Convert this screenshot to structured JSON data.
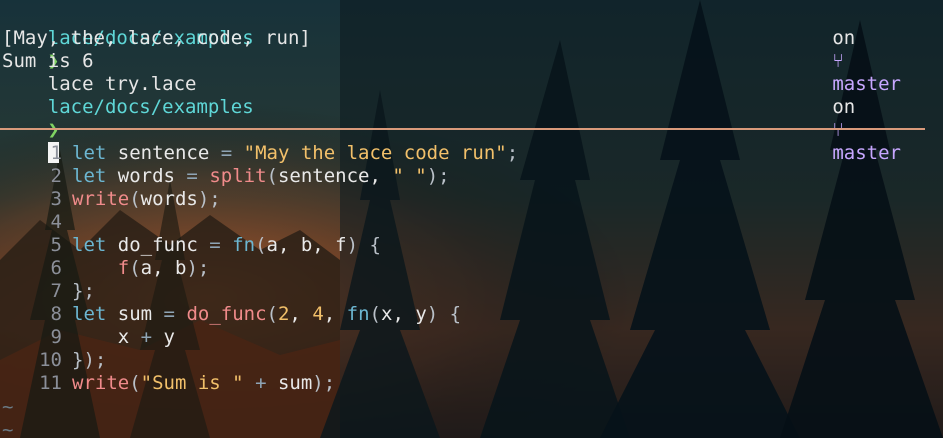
{
  "prompt": {
    "path": "lace/docs/examples",
    "chevron": "❯",
    "on_label": "on",
    "branch_icon": "git-branch-icon",
    "branch": "master"
  },
  "history": {
    "command": "lace try.lace",
    "output_1": "[May, the, lace, code, run]",
    "output_2": "Sum is 6"
  },
  "editor": {
    "lines": [
      {
        "n": "1",
        "tokens": [
          {
            "t": "let",
            "c": "kw"
          },
          {
            "t": " sentence ",
            "c": "id"
          },
          {
            "t": "=",
            "c": "op"
          },
          {
            "t": " ",
            "c": "id"
          },
          {
            "t": "\"May the lace code run\"",
            "c": "str"
          },
          {
            "t": ";",
            "c": "pun"
          }
        ]
      },
      {
        "n": "2",
        "tokens": [
          {
            "t": "let",
            "c": "kw"
          },
          {
            "t": " words ",
            "c": "id"
          },
          {
            "t": "=",
            "c": "op"
          },
          {
            "t": " ",
            "c": "id"
          },
          {
            "t": "split",
            "c": "fnc"
          },
          {
            "t": "(",
            "c": "pun"
          },
          {
            "t": "sentence, ",
            "c": "id"
          },
          {
            "t": "\" \"",
            "c": "str"
          },
          {
            "t": ");",
            "c": "pun"
          }
        ]
      },
      {
        "n": "3",
        "tokens": [
          {
            "t": "write",
            "c": "fnc"
          },
          {
            "t": "(",
            "c": "pun"
          },
          {
            "t": "words",
            "c": "id"
          },
          {
            "t": ");",
            "c": "pun"
          }
        ]
      },
      {
        "n": "4",
        "tokens": []
      },
      {
        "n": "5",
        "tokens": [
          {
            "t": "let",
            "c": "kw"
          },
          {
            "t": " do_func ",
            "c": "id"
          },
          {
            "t": "=",
            "c": "op"
          },
          {
            "t": " ",
            "c": "id"
          },
          {
            "t": "fn",
            "c": "kw"
          },
          {
            "t": "(",
            "c": "pun"
          },
          {
            "t": "a, b, f",
            "c": "id"
          },
          {
            "t": ") {",
            "c": "pun"
          }
        ]
      },
      {
        "n": "6",
        "tokens": [
          {
            "t": "    ",
            "c": "id"
          },
          {
            "t": "f",
            "c": "fnc"
          },
          {
            "t": "(",
            "c": "pun"
          },
          {
            "t": "a, b",
            "c": "id"
          },
          {
            "t": ");",
            "c": "pun"
          }
        ]
      },
      {
        "n": "7",
        "tokens": [
          {
            "t": "};",
            "c": "pun"
          }
        ]
      },
      {
        "n": "8",
        "tokens": [
          {
            "t": "let",
            "c": "kw"
          },
          {
            "t": " sum ",
            "c": "id"
          },
          {
            "t": "=",
            "c": "op"
          },
          {
            "t": " ",
            "c": "id"
          },
          {
            "t": "do_func",
            "c": "fnc"
          },
          {
            "t": "(",
            "c": "pun"
          },
          {
            "t": "2",
            "c": "num"
          },
          {
            "t": ", ",
            "c": "id"
          },
          {
            "t": "4",
            "c": "num"
          },
          {
            "t": ", ",
            "c": "id"
          },
          {
            "t": "fn",
            "c": "kw"
          },
          {
            "t": "(",
            "c": "pun"
          },
          {
            "t": "x, y",
            "c": "id"
          },
          {
            "t": ") {",
            "c": "pun"
          }
        ]
      },
      {
        "n": "9",
        "tokens": [
          {
            "t": "    x ",
            "c": "id"
          },
          {
            "t": "+",
            "c": "op"
          },
          {
            "t": " y",
            "c": "id"
          }
        ]
      },
      {
        "n": "10",
        "tokens": [
          {
            "t": "});",
            "c": "pun"
          }
        ]
      },
      {
        "n": "11",
        "tokens": [
          {
            "t": "write",
            "c": "fnc"
          },
          {
            "t": "(",
            "c": "pun"
          },
          {
            "t": "\"Sum is \"",
            "c": "str"
          },
          {
            "t": " ",
            "c": "id"
          },
          {
            "t": "+",
            "c": "op"
          },
          {
            "t": " sum",
            "c": "id"
          },
          {
            "t": ");",
            "c": "pun"
          }
        ]
      }
    ],
    "empty_marker": "~"
  },
  "colors": {
    "path": "#5fd7d7",
    "chevron": "#7fd362",
    "branch": "#c7a7ff",
    "divider": "#d99a7b",
    "keyword": "#6cb6d1",
    "function": "#f08b8b",
    "string": "#f2c06a"
  }
}
